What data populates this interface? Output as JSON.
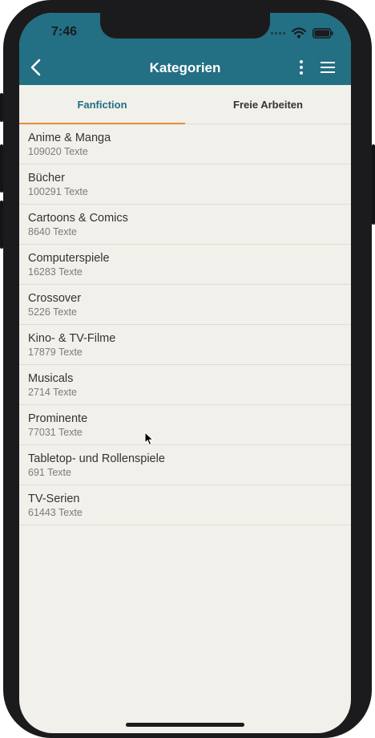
{
  "status": {
    "time": "7:46",
    "icons": [
      "signal-dots-icon",
      "wifi-icon",
      "battery-icon"
    ]
  },
  "navbar": {
    "title": "Kategorien",
    "back_icon": "chevron-left-icon",
    "more_icon": "more-vertical-icon",
    "menu_icon": "menu-icon"
  },
  "tabs": [
    {
      "label": "Fanfiction",
      "active": true
    },
    {
      "label": "Freie Arbeiten",
      "active": false
    }
  ],
  "categories": [
    {
      "title": "Anime & Manga",
      "count": "109020 Texte"
    },
    {
      "title": "Bücher",
      "count": "100291 Texte"
    },
    {
      "title": "Cartoons & Comics",
      "count": "8640 Texte"
    },
    {
      "title": "Computerspiele",
      "count": "16283 Texte"
    },
    {
      "title": "Crossover",
      "count": "5226 Texte"
    },
    {
      "title": "Kino- & TV-Filme",
      "count": "17879 Texte"
    },
    {
      "title": "Musicals",
      "count": "2714 Texte"
    },
    {
      "title": "Prominente",
      "count": "77031 Texte"
    },
    {
      "title": "Tabletop- und Rollenspiele",
      "count": "691 Texte"
    },
    {
      "title": "TV-Serien",
      "count": "61443 Texte"
    }
  ],
  "colors": {
    "topbar": "#236f84",
    "active_tab_text": "#1f6f86",
    "active_tab_underline": "#e38c3b",
    "background": "#f1f0ea"
  }
}
